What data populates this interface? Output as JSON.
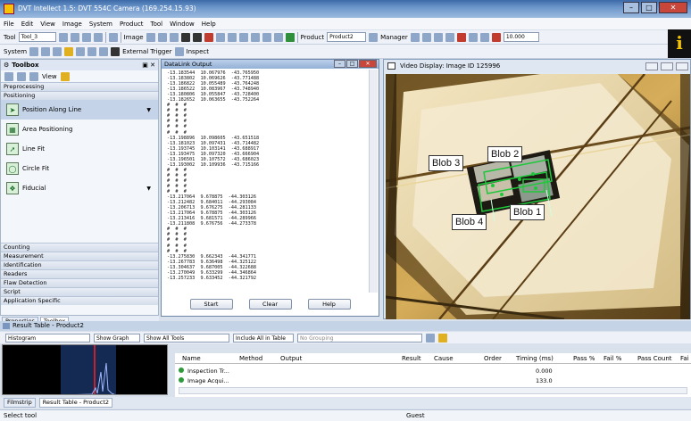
{
  "window": {
    "title": "DVT Intellect 1.5: DVT 554C Camera (169.254.15.93)",
    "min": "–",
    "max": "□",
    "close": "✕"
  },
  "menu": [
    "File",
    "Edit",
    "View",
    "Image",
    "System",
    "Product",
    "Tool",
    "Window",
    "Help"
  ],
  "toolbar1": {
    "tool_label": "Tool",
    "tool_select": "Tool_3",
    "image_label": "Image",
    "product_label": "Product",
    "product_select": "Product2",
    "manager_label": "Manager",
    "zoom_value": "10.000"
  },
  "toolbar2": {
    "system_label": "System",
    "external_trigger": "External Trigger",
    "inspect": "Inspect"
  },
  "toolbox": {
    "title": "Toolbox",
    "view_label": "View",
    "sections_top": [
      "Preprocessing",
      "Positioning"
    ],
    "tools": [
      {
        "label": "Position Along Line",
        "icon": "arrow-line-icon"
      },
      {
        "label": "Area Positioning",
        "icon": "area-grid-icon"
      },
      {
        "label": "Line Fit",
        "icon": "line-fit-icon"
      },
      {
        "label": "Circle Fit",
        "icon": "circle-fit-icon"
      },
      {
        "label": "Fiducial",
        "icon": "fiducial-icon"
      }
    ],
    "sections_bottom": [
      "Counting",
      "Measurement",
      "Identification",
      "Readers",
      "Flaw Detection",
      "Script",
      "Application Specific"
    ],
    "tabs": [
      "Properties",
      "Toolbox"
    ]
  },
  "datalink": {
    "title": "DataLink Output",
    "lines": [
      "-13.183544  10.067976  -43.765950",
      "-13.183802  10.069626  -43.771488",
      "-13.186822  10.055489  -43.764248",
      "-13.186522  10.083967  -43.748940",
      "-13.180806  10.055847  -43.728400",
      "-13.182652  10.063655  -43.752264",
      "#  #  #",
      "#  #  #",
      "#  #  #",
      "#  #  #",
      "#  #  #",
      "#  #  #",
      "-13.198896  10.098605  -43.651518",
      "-13.181023  10.097431  -43.714482",
      "-13.193745  10.103141  -43.688917",
      "-13.193475  10.097320  -43.666904",
      "-13.196501  10.107572  -43.686023",
      "-13.193002  10.109936  -43.715166",
      "#  #  #",
      "#  #  #",
      "#  #  #",
      "#  #  #",
      "#  #  #",
      "-13.217064  9.678875  -44.303126",
      "-13.212482  9.684011  -44.293084",
      "-13.206713  9.676275  -44.281133",
      "-13.217064  9.678875  -44.303126",
      "-13.213416  9.681571  -44.289966",
      "-13.211808  9.676756  -44.273378",
      "#  #  #",
      "#  #  #",
      "#  #  #",
      "#  #  #",
      "#  #  #",
      "-13.275830  9.662343  -44.341771",
      "-13.267783  9.636498  -44.325122",
      "-13.304637  9.687005  -44.322688",
      "-13.270049  9.633299  -44.346864",
      "-13.257233  9.633452  -44.321792"
    ],
    "buttons": {
      "start": "Start",
      "clear": "Clear",
      "help": "Help"
    }
  },
  "video": {
    "title": "Video Display: Image ID 125996",
    "blobs": [
      "Blob 1",
      "Blob 2",
      "Blob 3",
      "Blob 4"
    ]
  },
  "result_table": {
    "title": "Result Table - Product2",
    "view_select": "Histogram",
    "show_graph": "Show Graph",
    "show_all_tools": "Show All Tools",
    "include_all": "Include All in Table",
    "grouping": "No Grouping",
    "columns": [
      "Name",
      "Method",
      "Output",
      "Result",
      "Cause",
      "Order",
      "Timing (ms)",
      "Pass %",
      "Fail %",
      "Pass Count",
      "Fai"
    ],
    "rows": [
      {
        "name": "Inspection Tr...",
        "timing": "0.000"
      },
      {
        "name": "Image Acqui...",
        "timing": "133.0"
      }
    ]
  },
  "bottom_tabs": [
    "Filmstrip",
    "Result Table - Product2"
  ],
  "status": {
    "left": "Select tool",
    "middle": "Guest"
  }
}
